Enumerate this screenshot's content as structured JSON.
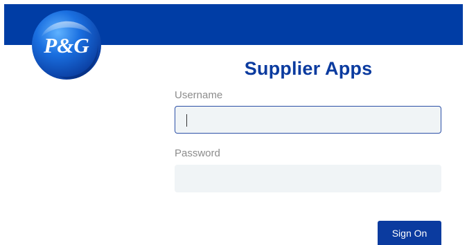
{
  "brand": {
    "logo_text": "P&G",
    "band_color": "#003da5",
    "accent_color": "#0b3b9f"
  },
  "title": "Supplier Apps",
  "form": {
    "username": {
      "label": "Username",
      "value": ""
    },
    "password": {
      "label": "Password",
      "value": ""
    },
    "submit_label": "Sign On"
  }
}
